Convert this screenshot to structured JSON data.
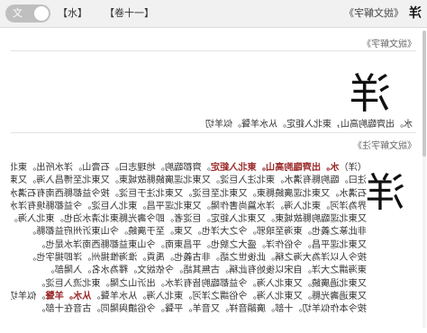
{
  "header": {
    "toggle_label": "文",
    "crumb_water": "【水】",
    "crumb_volume": "【卷十一】",
    "crumb_sep": "",
    "book_title": "《說文解字》",
    "headword": "洋"
  },
  "section1": {
    "label": "《說文解字》",
    "glyph": "洋",
    "definition": "水。出齊臨朐高山，東北入鉅定。从水羊聲。似羊切"
  },
  "section2": {
    "label": "《說文解字注》",
    "glyph": "洋",
    "lines": [
      {
        "plain": "（洋）",
        "hl": "水。出齊臨朐高山。東北入鉅定",
        "rest": "。齊郡臨朐。地理志曰。石膏山。洋水所出。東北至廣饒入鉅定。水經"
      },
      {
        "plain": "注曰。臨朐縣有溝水。東北注入巨淀。又東北逕廣饒縣故城東。又東北至博昌入海。又東北出。左合"
      },
      {
        "plain": "石溝水。又東北逕廣饒縣東。又東北至巨淀。又東北注于巨淀。按今益都縣西南有石溝水。又東北入壽光縣"
      },
      {
        "plain": "界為洋河。東北入海。洋水篇尚書作陽。又東北逕平昌。東北入巨淀。今益都縣境有洋水。"
      },
      {
        "plain": "又東北逕臨朐縣故城東。又東北入鉅定。巨淀者。即今壽光縣東北清水泊也。東北入海。"
      },
      {
        "plain": "非此篆之義也。東海至琅邪。今之大洋也。又東。至于廣饒。今山東沂州府益都縣。"
      },
      {
        "plain": "又東北逕平昌。今俗作洋。盛大之貌也。平昌東南。今山東益都縣西南洋水是也。"
      },
      {
        "plain": "按今人以洋為大海之稱。此後世之語。非古義也。禹貢。淮海惟揚州。洋即揚字也。"
      },
      {
        "plain": "東海謂之大洋。自宋以後始有此稱。古無其語。今依說文。釋為水名。入陽部。"
      },
      {
        "plain": "又東北過廣饒。又東北入海。今益都臨朐皆有洋水。出沂山之陽。東北流入巨淀。"
      },
      {
        "plain": "又東過壽光縣。又東北入海。今俗謂之洋河。東北入海。从水羊聲。",
        "hl2": "从水。羊聲",
        "rest2": "。似羊切。十部。"
      },
      {
        "plain": "按今本作似羊切。十部。廣韻音祥。又音羊。平聲。今俗讀與陽同。古音在十部。"
      }
    ]
  }
}
